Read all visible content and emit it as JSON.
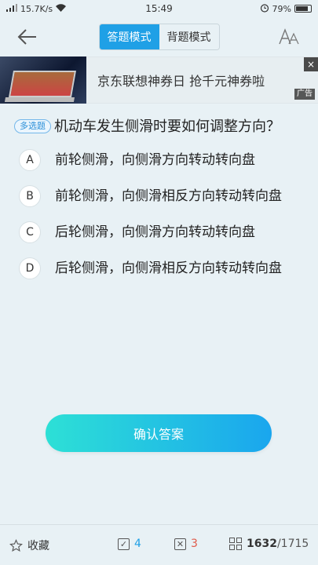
{
  "status_bar": {
    "network_speed": "15.7K/s",
    "time": "15:49",
    "battery": "79%"
  },
  "nav": {
    "tabs": [
      {
        "label": "答题模式",
        "active": true
      },
      {
        "label": "背题模式",
        "active": false
      }
    ],
    "font_icon_label": "A"
  },
  "ad": {
    "text": "京东联想神券日 抢千元神券啦",
    "tag": "广告",
    "close": "×"
  },
  "question": {
    "type_badge": "多选题",
    "text": "机动车发生侧滑时要如何调整方向？"
  },
  "options": [
    {
      "letter": "A",
      "text": "前轮侧滑，向侧滑方向转动转向盘"
    },
    {
      "letter": "B",
      "text": "前轮侧滑，向侧滑相反方向转动转向盘"
    },
    {
      "letter": "C",
      "text": "后轮侧滑，向侧滑方向转动转向盘"
    },
    {
      "letter": "D",
      "text": "后轮侧滑，向侧滑相反方向转动转向盘"
    }
  ],
  "confirm_button": "确认答案",
  "bottom_bar": {
    "collect_label": "收藏",
    "correct_count": "4",
    "wrong_count": "3",
    "current": "1632",
    "total": "/1715"
  },
  "colors": {
    "accent": "#1fa0e6",
    "wrong": "#e05a4a",
    "background": "#e8f1f5"
  }
}
